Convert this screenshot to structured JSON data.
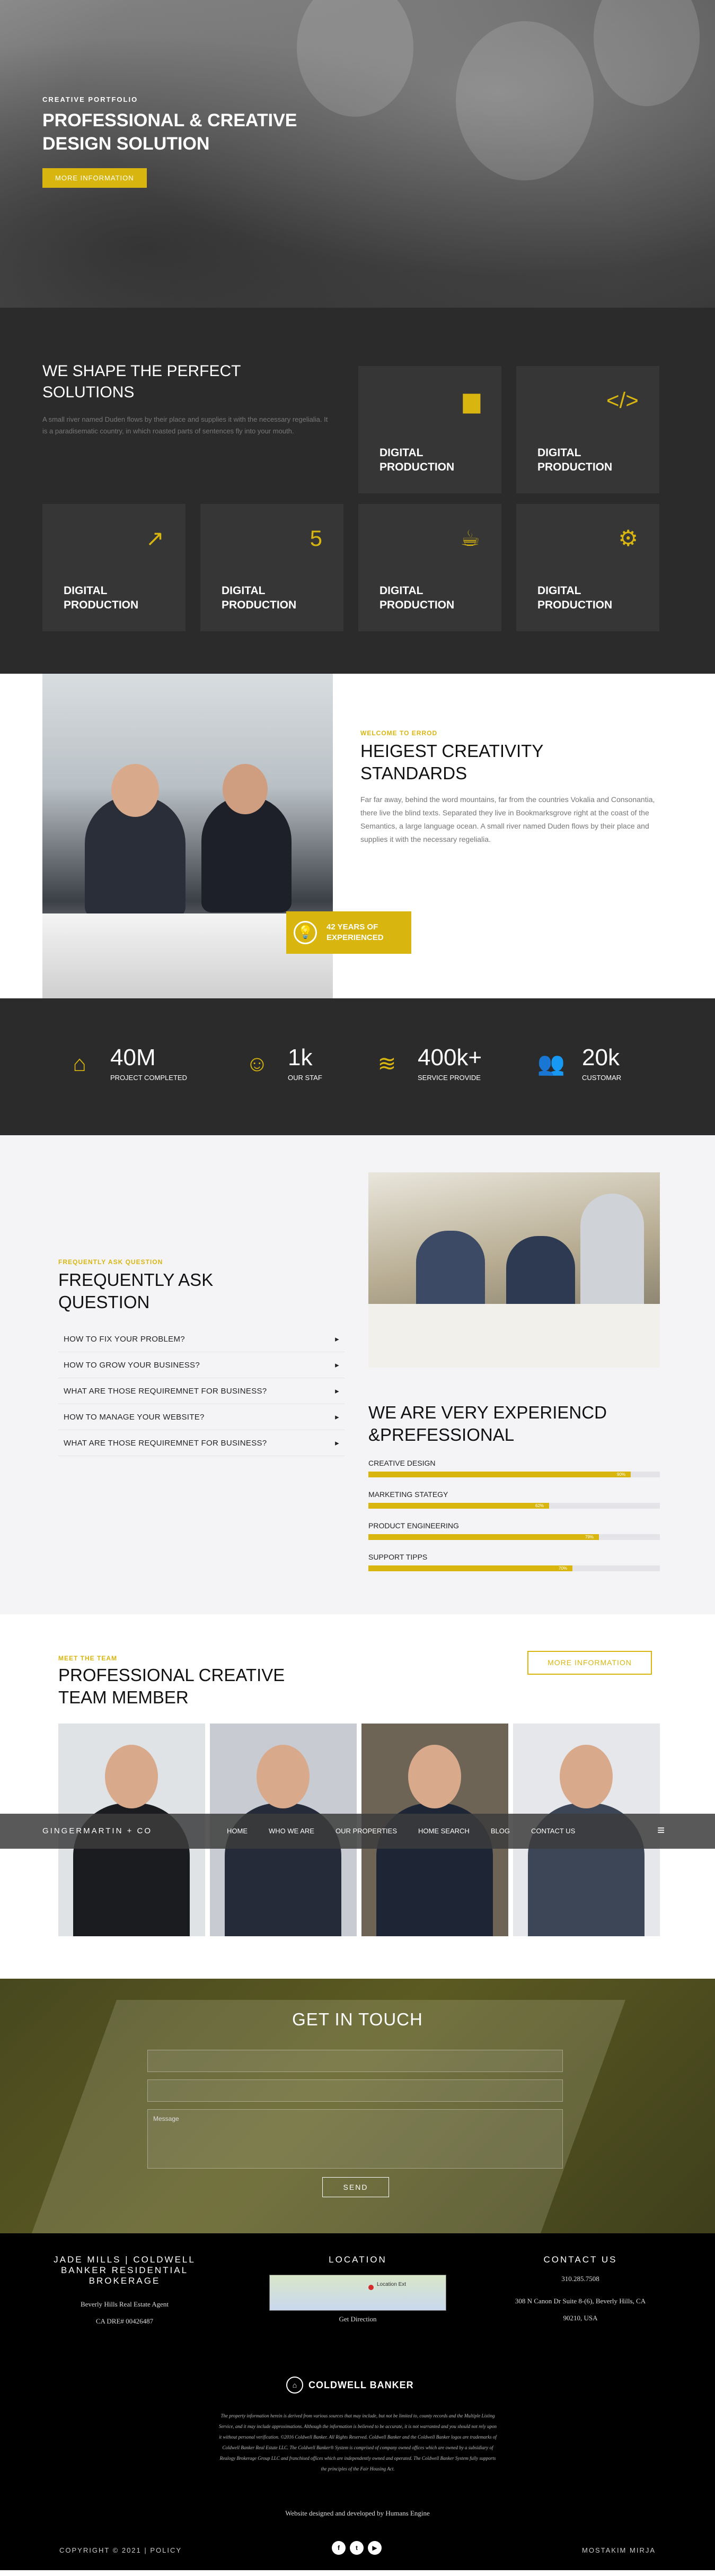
{
  "hero": {
    "kicker": "CREATIVE PORTFOLIO",
    "title": "PROFESSIONAL & CREATIVE DESIGN SOLUTION",
    "button": "MORE INFORMATION"
  },
  "solutions": {
    "title": "WE SHAPE THE PERFECT SOLUTIONS",
    "text": "A small river named Duden flows by their place and supplies it with the necessary regelialia. It is a paradisematic country, in which roasted parts of sentences fly into your mouth.",
    "cards": [
      {
        "title": "DIGITAL PRODUCTION",
        "icon": "bar-chart-icon",
        "glyph": "▆"
      },
      {
        "title": "DIGITAL PRODUCTION",
        "icon": "code-icon",
        "glyph": "</>"
      },
      {
        "title": "DIGITAL PRODUCTION",
        "icon": "line-chart-icon",
        "glyph": "↗"
      },
      {
        "title": "DIGITAL PRODUCTION",
        "icon": "html5-icon",
        "glyph": "5"
      },
      {
        "title": "DIGITAL PRODUCTION",
        "icon": "java-icon",
        "glyph": "☕"
      },
      {
        "title": "DIGITAL PRODUCTION",
        "icon": "users-gear-icon",
        "glyph": "⚙"
      }
    ]
  },
  "about": {
    "kicker": "WELCOME TO ERROD",
    "title": "HEIGEST CREATIVITY STANDARDS",
    "text": "Far far away, behind the word mountains, far from the countries Vokalia and Consonantia, there live the blind texts. Separated they live in Bookmarksgrove right at the coast of the Semantics, a large language ocean. A small river named Duden flows by their place and supplies it with the necessary regelialia.",
    "badge": "42 YEARS OF EXPERIENCED"
  },
  "stats": [
    {
      "num": "40M",
      "label": "PROJECT COMPLETED",
      "icon": "house-icon",
      "glyph": "⌂"
    },
    {
      "num": "1k",
      "label": "OUR STAF",
      "icon": "user-circle-icon",
      "glyph": "☺"
    },
    {
      "num": "400k+",
      "label": "SERVICE PROVIDE",
      "icon": "layers-icon",
      "glyph": "≋"
    },
    {
      "num": "20k",
      "label": "CUSTOMAR",
      "icon": "users-icon",
      "glyph": "👥"
    }
  ],
  "faq": {
    "kicker": "FREQUENTLY ASK QUESTION",
    "title": "FREQUENTLY ASK QUESTION",
    "questions": [
      "HOW TO FIX YOUR PROBLEM?",
      "HOW TO GROW YOUR BUSINESS?",
      "WHAT ARE THOSE REQUIREMNET FOR BUSINESS?",
      "HOW TO MANAGE YOUR WEBSITE?",
      "WHAT ARE THOSE REQUIREMNET FOR BUSINESS?"
    ]
  },
  "experience": {
    "title": "WE ARE VERY EXPERIENCD &PREFESSIONAL",
    "skills": [
      {
        "label": "CREATIVE DESIGN",
        "pct_text": "90%",
        "value": 0.9
      },
      {
        "label": "MARKETING STATEGY",
        "pct_text": "62%",
        "value": 0.62
      },
      {
        "label": "PRODUCT ENGINEERING",
        "pct_text": "79%",
        "value": 0.79
      },
      {
        "label": "SUPPORT TIPPS",
        "pct_text": "70%",
        "value": 0.7
      }
    ]
  },
  "team": {
    "kicker": "MEET THE TEAM",
    "title": "PROFESSIONAL CREATIVE TEAM MEMBER",
    "button": "MORE INFORMATION",
    "members": [
      {
        "bg": "#dfe3e6",
        "suit": "#1b1c20"
      },
      {
        "bg": "#c8ccd2",
        "suit": "#252b38"
      },
      {
        "bg": "#6e6456",
        "suit": "#1e2636"
      },
      {
        "bg": "#e6e7ea",
        "suit": "#3c4656"
      }
    ]
  },
  "nav": {
    "brand": "GINGERMARTIN + CO",
    "links": [
      "HOME",
      "WHO WE ARE",
      "OUR PROPERTIES",
      "HOME SEARCH",
      "BLOG",
      "CONTACT US"
    ]
  },
  "contact_form": {
    "title": "GET IN TOUCH",
    "message_placeholder": "Message",
    "send": "SEND"
  },
  "footer": {
    "col1_title": "JADE MILLS | COLDWELL BANKER RESIDENTIAL BROKERAGE",
    "col1_line1": "Beverly Hills Real Estate Agent",
    "col1_line2": "CA DRE# 00426487",
    "col2_title": "LOCATION",
    "map_label": "Location Ext",
    "get_direction": "Get Direction",
    "col3_title": "CONTACT US",
    "phone": "310.285.7508",
    "address1": "308 N Canon Dr Suite 8-(6), Beverly Hills, CA",
    "address2": "90210, USA",
    "brand": "COLDWELL BANKER",
    "legal": "The property information herein is derived from various sources that may include, but not be limited to, county records and the Multiple Listing Service, and it may include approximations. Although the information is believed to be accurate, it is not warranted and you should not rely upon it without personal verification. ©2016 Coldwell Banker. All Rights Reserved. Coldwell Banker and the Coldwell Banker logos are trademarks of Coldwell Banker Real Estate LLC. The Coldwell Banker® System is comprised of company owned offices which are owned by a subsidiary of Realogy Brokerage Group LLC and franchised offices which are independently owned and operated. The Coldwell Banker System fully supports the principles of the Fair Housing Act.",
    "designed": "Website designed and developed by Humans Engine",
    "copyright": "COPYRIGHT © 2021 | POLICY",
    "author": "MOSTAKIM MIRJA",
    "social": [
      "f",
      "t",
      "▶"
    ]
  },
  "colors": {
    "accent": "#d8b60f",
    "dark": "#2b2b2b",
    "light": "#f4f4f7"
  }
}
